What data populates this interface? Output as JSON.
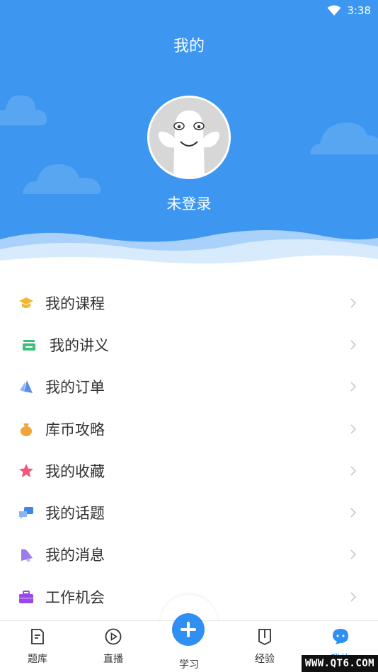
{
  "status_bar": {
    "time": "3:38"
  },
  "header": {
    "title": "我的",
    "login_status": "未登录"
  },
  "menu": [
    {
      "label": "我的课程",
      "icon": "graduation-cap-icon",
      "color": "#f5b731"
    },
    {
      "label": "我的讲义",
      "icon": "handout-icon",
      "color": "#3dbf7b"
    },
    {
      "label": "我的订单",
      "icon": "order-icon",
      "color": "#5b8ee8"
    },
    {
      "label": "库币攻略",
      "icon": "money-bag-icon",
      "color": "#f0a43a"
    },
    {
      "label": "我的收藏",
      "icon": "star-icon",
      "color": "#ef5a7a"
    },
    {
      "label": "我的话题",
      "icon": "chat-bubbles-icon",
      "color": "#3f86e6"
    },
    {
      "label": "我的消息",
      "icon": "bell-icon",
      "color": "#9b7cf0"
    },
    {
      "label": "工作机会",
      "icon": "briefcase-icon",
      "color": "#9a48e6"
    }
  ],
  "bottom_nav": [
    {
      "label": "题库",
      "icon": "question-bank-icon"
    },
    {
      "label": "直播",
      "icon": "play-icon"
    },
    {
      "label": "学习",
      "icon": "plus-icon"
    },
    {
      "label": "经验",
      "icon": "bookmark-icon"
    },
    {
      "label": "我的",
      "icon": "chat-face-icon",
      "active": true
    }
  ],
  "watermark": "WWW.QT6.COM",
  "colors": {
    "brand": "#3d97f0",
    "accent": "#2f8ff2"
  }
}
